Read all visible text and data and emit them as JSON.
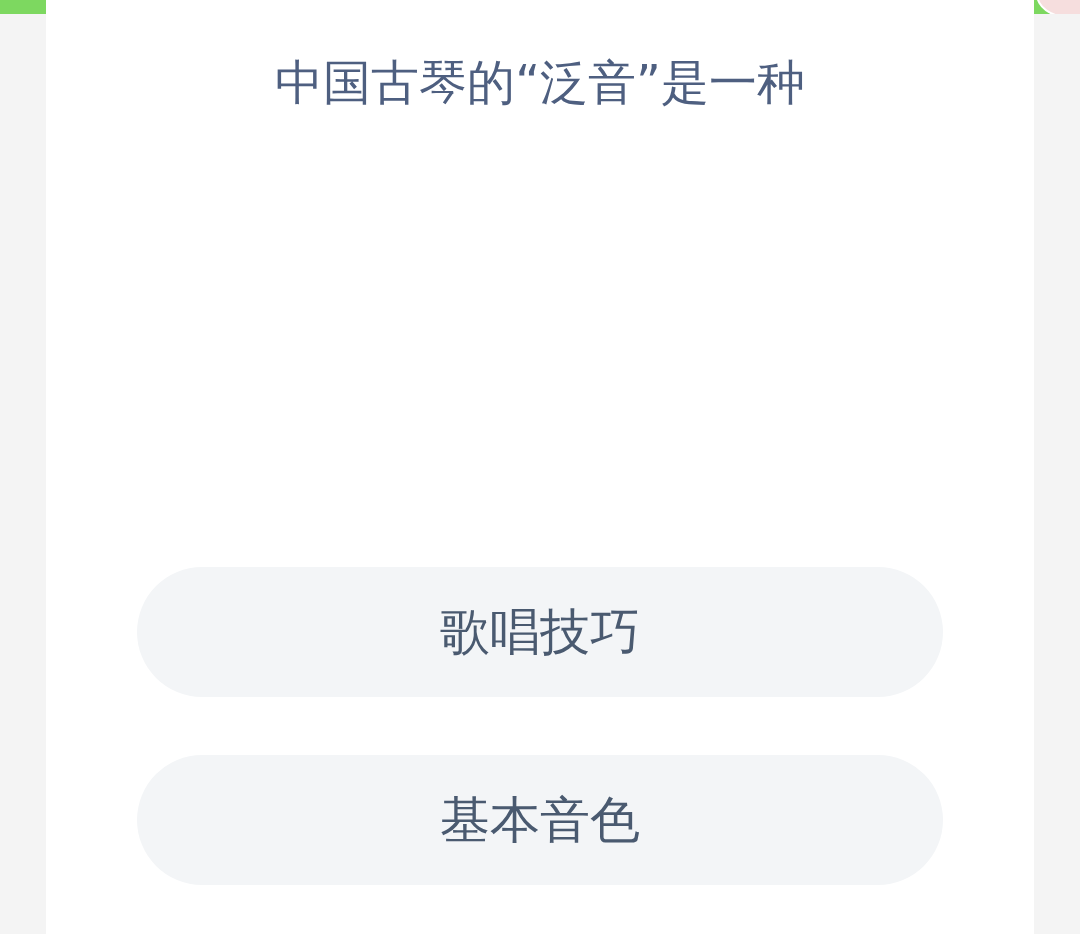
{
  "question": "中国古琴的“泛音”是一种",
  "options": [
    {
      "label": "歌唱技巧"
    },
    {
      "label": "基本音色"
    }
  ]
}
